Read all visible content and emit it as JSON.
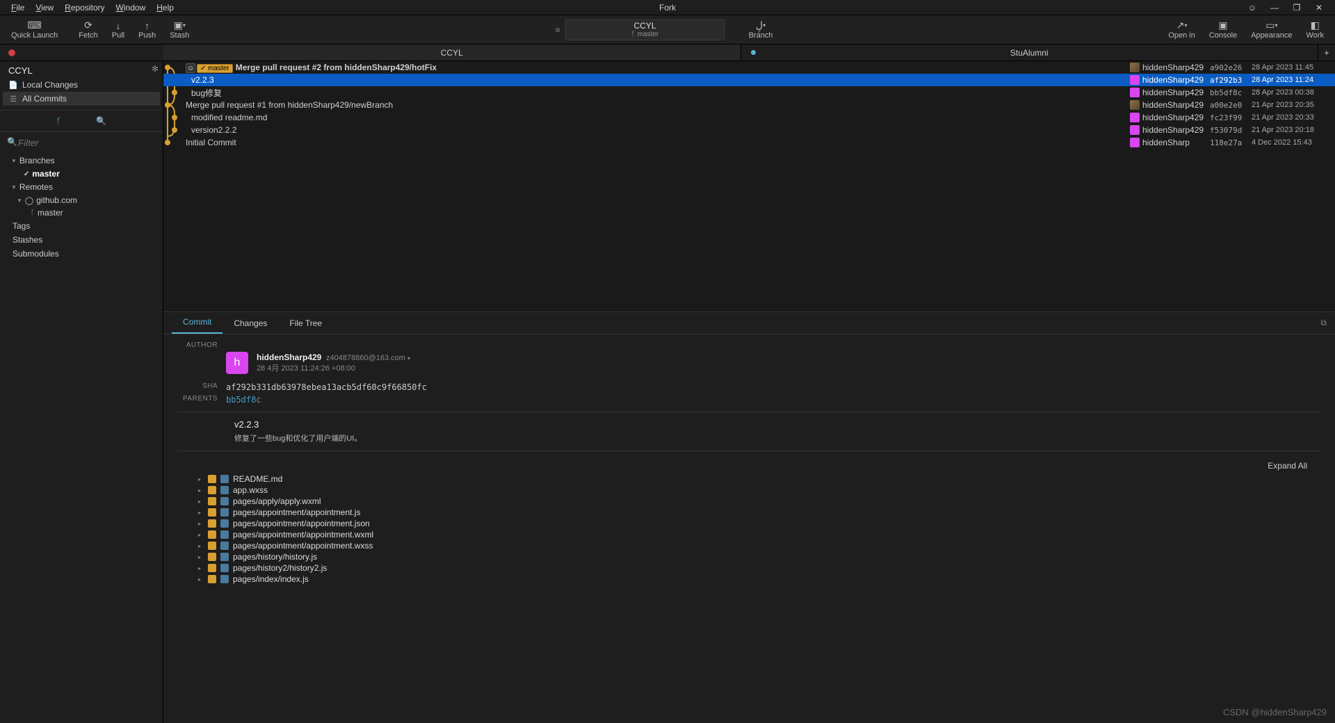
{
  "app_title": "Fork",
  "menus": [
    "File",
    "View",
    "Repository",
    "Window",
    "Help"
  ],
  "toolbar": {
    "quick_launch": "Quick Launch",
    "fetch": "Fetch",
    "pull": "Pull",
    "push": "Push",
    "stash": "Stash",
    "branch": "Branch",
    "open_in": "Open in",
    "console": "Console",
    "appearance": "Appearance",
    "work": "Work",
    "repo_name": "CCYL",
    "repo_branch": "master"
  },
  "workspace_tabs": [
    {
      "name": "CCYL",
      "dot": null,
      "active": true
    },
    {
      "name": "StuAlumni",
      "dot": "#5ab5d8",
      "active": false
    }
  ],
  "sidebar": {
    "repo": "CCYL",
    "local_changes": "Local Changes",
    "all_commits": "All Commits",
    "filter_placeholder": "Filter",
    "branches": "Branches",
    "master": "master",
    "remotes": "Remotes",
    "github": "github.com",
    "remote_master": "master",
    "tags": "Tags",
    "stashes": "Stashes",
    "submodules": "Submodules"
  },
  "commits": [
    {
      "msg": "Merge pull request #2 from hiddenSharp429/hotFix",
      "author": "hiddenSharp429",
      "hash": "a902e26",
      "date": "28 Apr 2023 11:45",
      "avatar": "img",
      "tags": [
        "github",
        "master"
      ],
      "sel": false
    },
    {
      "msg": "v2.2.3",
      "author": "hiddenSharp429",
      "hash": "af292b3",
      "date": "28 Apr 2023 11:24",
      "avatar": "pink",
      "tags": [],
      "sel": true
    },
    {
      "msg": "bug修复",
      "author": "hiddenSharp429",
      "hash": "bb5df8c",
      "date": "28 Apr 2023 00:38",
      "avatar": "pink",
      "tags": [],
      "sel": false
    },
    {
      "msg": "Merge pull request #1 from hiddenSharp429/newBranch",
      "author": "hiddenSharp429",
      "hash": "a00e2e0",
      "date": "21 Apr 2023 20:35",
      "avatar": "img",
      "tags": [],
      "sel": false
    },
    {
      "msg": "modified readme.md",
      "author": "hiddenSharp429",
      "hash": "fc23f99",
      "date": "21 Apr 2023 20:33",
      "avatar": "pink",
      "tags": [],
      "sel": false
    },
    {
      "msg": "version2.2.2",
      "author": "hiddenSharp429",
      "hash": "f53079d",
      "date": "21 Apr 2023 20:18",
      "avatar": "pink",
      "tags": [],
      "sel": false
    },
    {
      "msg": "Initial Commit",
      "author": "hiddenSharp",
      "hash": "118e27a",
      "date": "4 Dec 2022 15:43",
      "avatar": "pink",
      "tags": [],
      "sel": false
    }
  ],
  "detail": {
    "tabs": {
      "commit": "Commit",
      "changes": "Changes",
      "file_tree": "File Tree"
    },
    "labels": {
      "author": "AUTHOR",
      "sha": "SHA",
      "parents": "PARENTS"
    },
    "author_name": "hiddenSharp429",
    "author_email": "z404878860@163.com",
    "author_date": "28 4月 2023 11:24:26 +08:00",
    "avatar_letter": "h",
    "sha": "af292b331db63978ebea13acb5df60c9f66850fc",
    "parent": "bb5df8c",
    "title": "v2.2.3",
    "body": "修复了一些bug和优化了用户端的UI。",
    "expand_all": "Expand All",
    "files": [
      "README.md",
      "app.wxss",
      "pages/apply/apply.wxml",
      "pages/appointment/appointment.js",
      "pages/appointment/appointment.json",
      "pages/appointment/appointment.wxml",
      "pages/appointment/appointment.wxss",
      "pages/history/history.js",
      "pages/history2/history2.js",
      "pages/index/index.js"
    ]
  },
  "watermark": "CSDN @hiddenSharp429"
}
